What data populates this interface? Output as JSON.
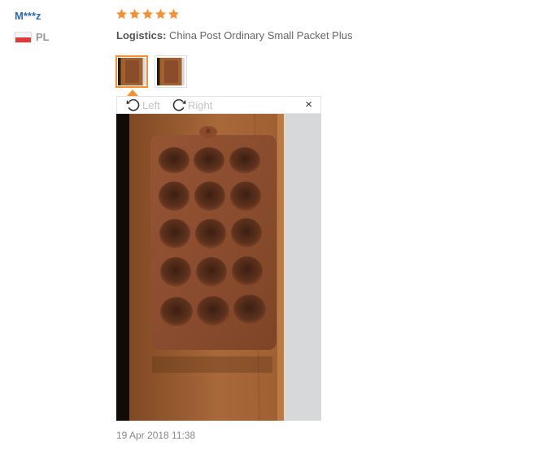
{
  "review": {
    "user": "M***z",
    "country_code": "PL",
    "rating": 5,
    "logistics_label": "Logistics:",
    "logistics_value": "China Post Ordinary Small Packet Plus",
    "date": "19 Apr 2018 11:38"
  },
  "viewer": {
    "rotate_left_label": "Left",
    "rotate_right_label": "Right",
    "close_symbol": "×"
  },
  "icons": {
    "star": "star-icon",
    "rotate_left": "rotate-left-icon",
    "rotate_right": "rotate-right-icon",
    "close": "close-icon",
    "flag": "poland-flag-icon"
  },
  "colors": {
    "username": "#2a6bb3",
    "star": "#f29135",
    "active_thumb_border": "#f29135",
    "tray": "#8a4d2c",
    "table": "#a0612f"
  }
}
